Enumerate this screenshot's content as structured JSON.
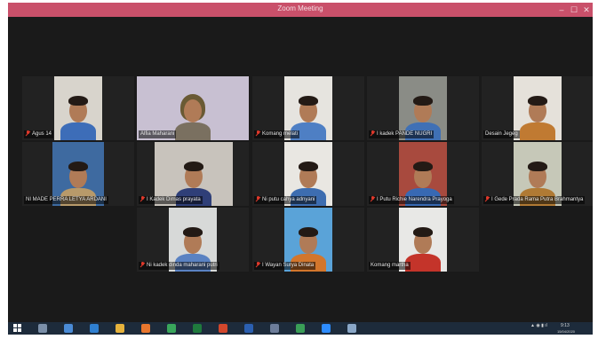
{
  "window": {
    "title": "Zoom Meeting",
    "minimize": "–",
    "maximize": "☐",
    "close": "✕"
  },
  "tiles": [
    {
      "name": "Agus 14",
      "muted": true,
      "bg": "#d8d4cc",
      "shirt": "#3d6db8",
      "active": false
    },
    {
      "name": "Alfia Maharani",
      "muted": false,
      "bg": "#c8c0d2",
      "shirt": "#7a7060",
      "active": true
    },
    {
      "name": "Komang melati",
      "muted": true,
      "bg": "#e6e4df",
      "shirt": "#4e7fc4",
      "active": false
    },
    {
      "name": "I kadek PANDE NUGRI",
      "muted": true,
      "bg": "#8a8c86",
      "shirt": "#3f70b5",
      "active": false
    },
    {
      "name": "Desain Jegeg",
      "muted": false,
      "bg": "#e5e1da",
      "shirt": "#c07a32",
      "active": false
    },
    {
      "name": "NI MADE PERRA LETYA ARDANI",
      "muted": false,
      "bg": "#3e6aa0",
      "shirt": "#b89a6a",
      "active": false
    },
    {
      "name": "I Kadek Dimas prayata",
      "muted": true,
      "bg": "#c8c3bc",
      "shirt": "#2f3f78",
      "active": false
    },
    {
      "name": "Ni putu cahya adnyani",
      "muted": true,
      "bg": "#e9e7e2",
      "shirt": "#3d6db0",
      "active": false
    },
    {
      "name": "I Putu Richie Narendra Prayoga",
      "muted": true,
      "bg": "#a84a3e",
      "shirt": "#3869b3",
      "active": false
    },
    {
      "name": "I Gede Prada Rama Putra Brahmantya",
      "muted": true,
      "bg": "#c6c8b8",
      "shirt": "#b07a34",
      "active": false
    },
    {
      "name": "Ni kadek dinda maharani putri",
      "muted": true,
      "bg": "#d7d9d8",
      "shirt": "#5a82c2",
      "active": false
    },
    {
      "name": "I Wayan Surya Dinata",
      "muted": true,
      "bg": "#5aa3d8",
      "shirt": "#d2762c",
      "active": false
    },
    {
      "name": "Komang martha",
      "muted": false,
      "bg": "#e8e8e6",
      "shirt": "#c4342a",
      "active": false
    }
  ],
  "taskbar": {
    "apps": [
      "file-explorer-icon",
      "browser-icon",
      "photos-icon",
      "folder-icon",
      "firefox-icon",
      "chrome-icon",
      "excel-icon",
      "powerpoint-icon",
      "word-icon",
      "document-icon",
      "chrome-alt-icon",
      "zoom-icon",
      "paint-icon"
    ],
    "time": "9:13",
    "date": "15/04/2020"
  },
  "colors": {
    "titlebar": "#c9506a",
    "active_border": "#a6d53a",
    "muted": "#e0392b",
    "taskbar": "#1d2b3b"
  }
}
